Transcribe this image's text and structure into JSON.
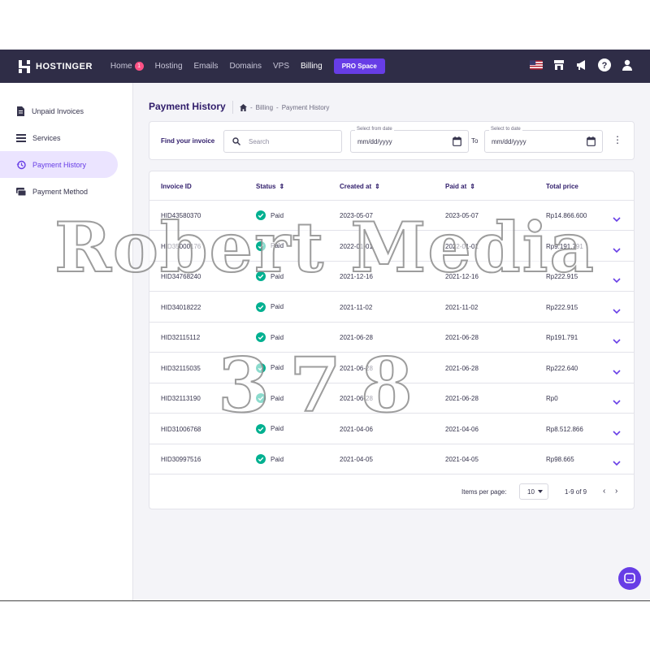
{
  "brand": {
    "name": "HOSTINGER"
  },
  "nav": {
    "items": [
      {
        "label": "Home",
        "badge": "1"
      },
      {
        "label": "Hosting"
      },
      {
        "label": "Emails"
      },
      {
        "label": "Domains"
      },
      {
        "label": "VPS"
      },
      {
        "label": "Billing"
      }
    ],
    "pro_label": "PRO Space"
  },
  "top_icons": [
    "us-flag-icon",
    "store-icon",
    "megaphone-icon",
    "help-icon",
    "user-icon"
  ],
  "sidebar": {
    "items": [
      {
        "label": "Unpaid Invoices",
        "icon": "document-icon"
      },
      {
        "label": "Services",
        "icon": "list-icon"
      },
      {
        "label": "Payment History",
        "icon": "history-icon"
      },
      {
        "label": "Payment Method",
        "icon": "card-icon"
      }
    ]
  },
  "page": {
    "title": "Payment History",
    "breadcrumb": [
      "Billing",
      "Payment History"
    ]
  },
  "filter": {
    "label": "Find your invoice",
    "search_placeholder": "Search",
    "from_label": "Select from date",
    "to_label": "Select to date",
    "date_placeholder": "mm/dd/yyyy",
    "to_text": "To"
  },
  "table": {
    "headers": [
      "Invoice ID",
      "Status",
      "Created at",
      "Paid at",
      "Total price"
    ],
    "rows": [
      {
        "id": "HID43580370",
        "status": "Paid",
        "created": "2023-05-07",
        "paid": "2023-05-07",
        "total": "Rp14.866.600"
      },
      {
        "id": "HID35000176",
        "status": "Paid",
        "created": "2022-01-01",
        "paid": "2022-01-01",
        "total": "Rp9.191.791"
      },
      {
        "id": "HID34768240",
        "status": "Paid",
        "created": "2021-12-16",
        "paid": "2021-12-16",
        "total": "Rp222.915"
      },
      {
        "id": "HID34018222",
        "status": "Paid",
        "created": "2021-11-02",
        "paid": "2021-11-02",
        "total": "Rp222.915"
      },
      {
        "id": "HID32115112",
        "status": "Paid",
        "created": "2021-06-28",
        "paid": "2021-06-28",
        "total": "Rp191.791"
      },
      {
        "id": "HID32115035",
        "status": "Paid",
        "created": "2021-06-28",
        "paid": "2021-06-28",
        "total": "Rp222.640"
      },
      {
        "id": "HID32113190",
        "status": "Paid",
        "created": "2021-06-28",
        "paid": "2021-06-28",
        "total": "Rp0"
      },
      {
        "id": "HID31006768",
        "status": "Paid",
        "created": "2021-04-06",
        "paid": "2021-04-06",
        "total": "Rp8.512.866"
      },
      {
        "id": "HID30997516",
        "status": "Paid",
        "created": "2021-04-05",
        "paid": "2021-04-05",
        "total": "Rp98.665"
      }
    ]
  },
  "pagination": {
    "items_per_page_label": "Items per page:",
    "items_per_page": "10",
    "range": "1-9 of 9"
  },
  "watermark": {
    "line1": "Robert Media",
    "line2": "378"
  },
  "colors": {
    "topbar": "#2f2d47",
    "accent": "#673de6",
    "paid_green": "#00b090",
    "active_bg": "#ebe4ff"
  }
}
